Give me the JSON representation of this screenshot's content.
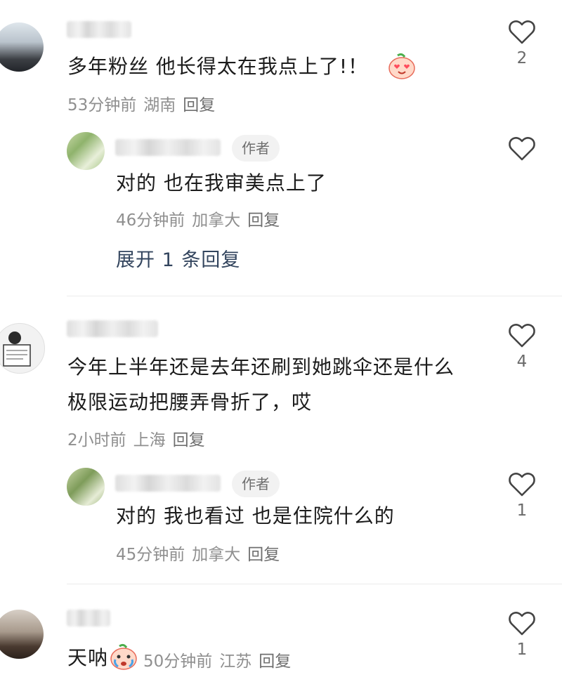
{
  "comments": [
    {
      "text": "多年粉丝 他长得太在我点上了!！",
      "time": "53分钟前",
      "location": "湖南",
      "reply_label": "回复",
      "likes": "2",
      "replies": [
        {
          "author_badge": "作者",
          "text": "对的 也在我审美点上了",
          "time": "46分钟前",
          "location": "加拿大",
          "reply_label": "回复",
          "likes": ""
        }
      ],
      "expand_label": "展开 1 条回复"
    },
    {
      "text_lines": [
        "今年上半年还是去年还刷到她跳伞还是什么",
        "极限运动把腰弄骨折了，哎"
      ],
      "time": "2小时前",
      "location": "上海",
      "reply_label": "回复",
      "likes": "4",
      "replies": [
        {
          "author_badge": "作者",
          "text": "对的 我也看过 也是住院什么的",
          "time": "45分钟前",
          "location": "加拿大",
          "reply_label": "回复",
          "likes": "1"
        }
      ]
    },
    {
      "text": "天呐",
      "time": "50分钟前",
      "location": "江苏",
      "reply_label": "回复",
      "likes": "1"
    }
  ],
  "icons": {
    "like": "heart-outline-icon",
    "emoji_love": "heart-eyes-emoji-icon",
    "emoji_cry": "crying-emoji-icon"
  }
}
